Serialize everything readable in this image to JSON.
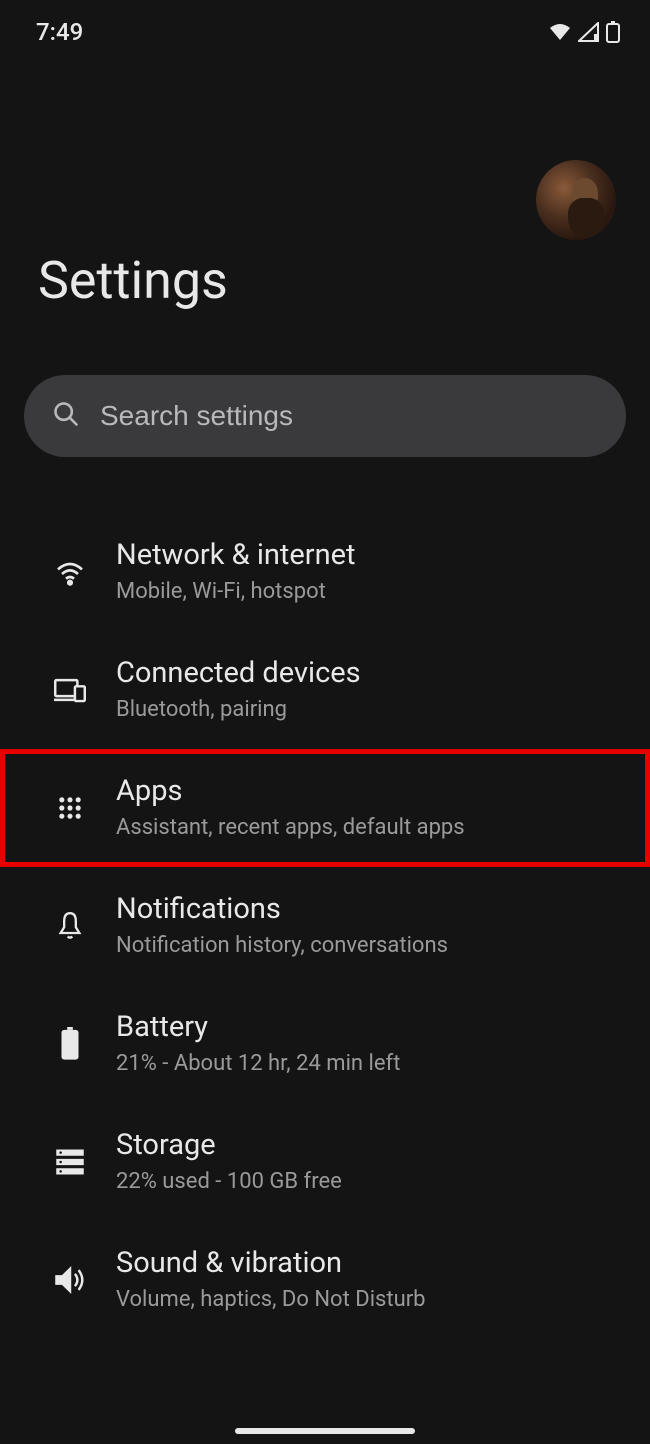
{
  "status": {
    "time": "7:49"
  },
  "page": {
    "title": "Settings"
  },
  "search": {
    "placeholder": "Search settings"
  },
  "items": [
    {
      "title": "Network & internet",
      "subtitle": "Mobile, Wi-Fi, hotspot",
      "icon": "wifi-icon",
      "highlighted": false
    },
    {
      "title": "Connected devices",
      "subtitle": "Bluetooth, pairing",
      "icon": "devices-icon",
      "highlighted": false
    },
    {
      "title": "Apps",
      "subtitle": "Assistant, recent apps, default apps",
      "icon": "apps-icon",
      "highlighted": true
    },
    {
      "title": "Notifications",
      "subtitle": "Notification history, conversations",
      "icon": "bell-icon",
      "highlighted": false
    },
    {
      "title": "Battery",
      "subtitle": "21% - About 12 hr, 24 min left",
      "icon": "battery-icon",
      "highlighted": false
    },
    {
      "title": "Storage",
      "subtitle": "22% used - 100 GB free",
      "icon": "storage-icon",
      "highlighted": false
    },
    {
      "title": "Sound & vibration",
      "subtitle": "Volume, haptics, Do Not Disturb",
      "icon": "sound-icon",
      "highlighted": false
    }
  ]
}
